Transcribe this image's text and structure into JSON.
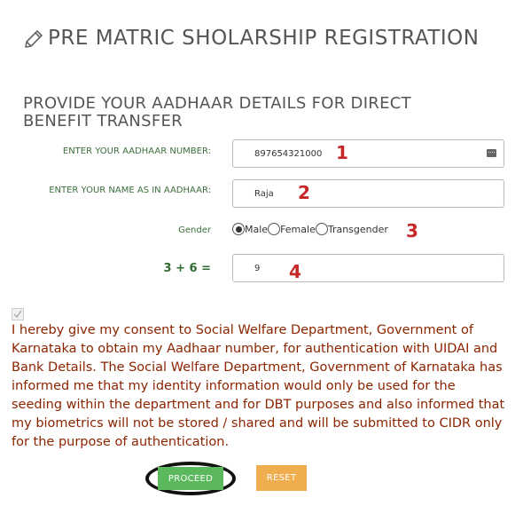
{
  "header": {
    "title": "PRE MATRIC SHOLARSHIP REGISTRATION",
    "icon": "pencil-icon"
  },
  "section": {
    "title": "PROVIDE YOUR AADHAAR DETAILS FOR DIRECT BENEFIT TRANSFER"
  },
  "form": {
    "aadhaar": {
      "label": "ENTER YOUR AADHAAR NUMBER:",
      "value": "897654321000"
    },
    "name": {
      "label": "ENTER YOUR NAME AS IN AADHAAR:",
      "value": "Raja"
    },
    "gender": {
      "label": "Gender",
      "options": [
        "Male",
        "Female",
        "Transgender"
      ],
      "selected": "Male"
    },
    "captcha": {
      "question": "3 + 6 =",
      "value": "9"
    }
  },
  "markers": [
    "1",
    "2",
    "3",
    "4"
  ],
  "consent": {
    "checked": true,
    "text": "I hereby give my consent to Social Welfare Department, Government of Karnataka to obtain my Aadhaar number, for authentication with UIDAI and Bank Details. The Social Welfare Department, Government of Karnataka has informed me that my identity information would only be used for the seeding within the department and for DBT purposes and also informed that my biometrics will not be stored / shared and will be submitted to CIDR only for the purpose of authentication."
  },
  "buttons": {
    "proceed": "PROCEED",
    "reset": "RESET"
  },
  "colors": {
    "label_green": "#3c6e3c",
    "consent_text": "#8b2500",
    "marker_red": "#c62828",
    "proceed_bg": "#5cb85c",
    "reset_bg": "#f0ad4e"
  }
}
